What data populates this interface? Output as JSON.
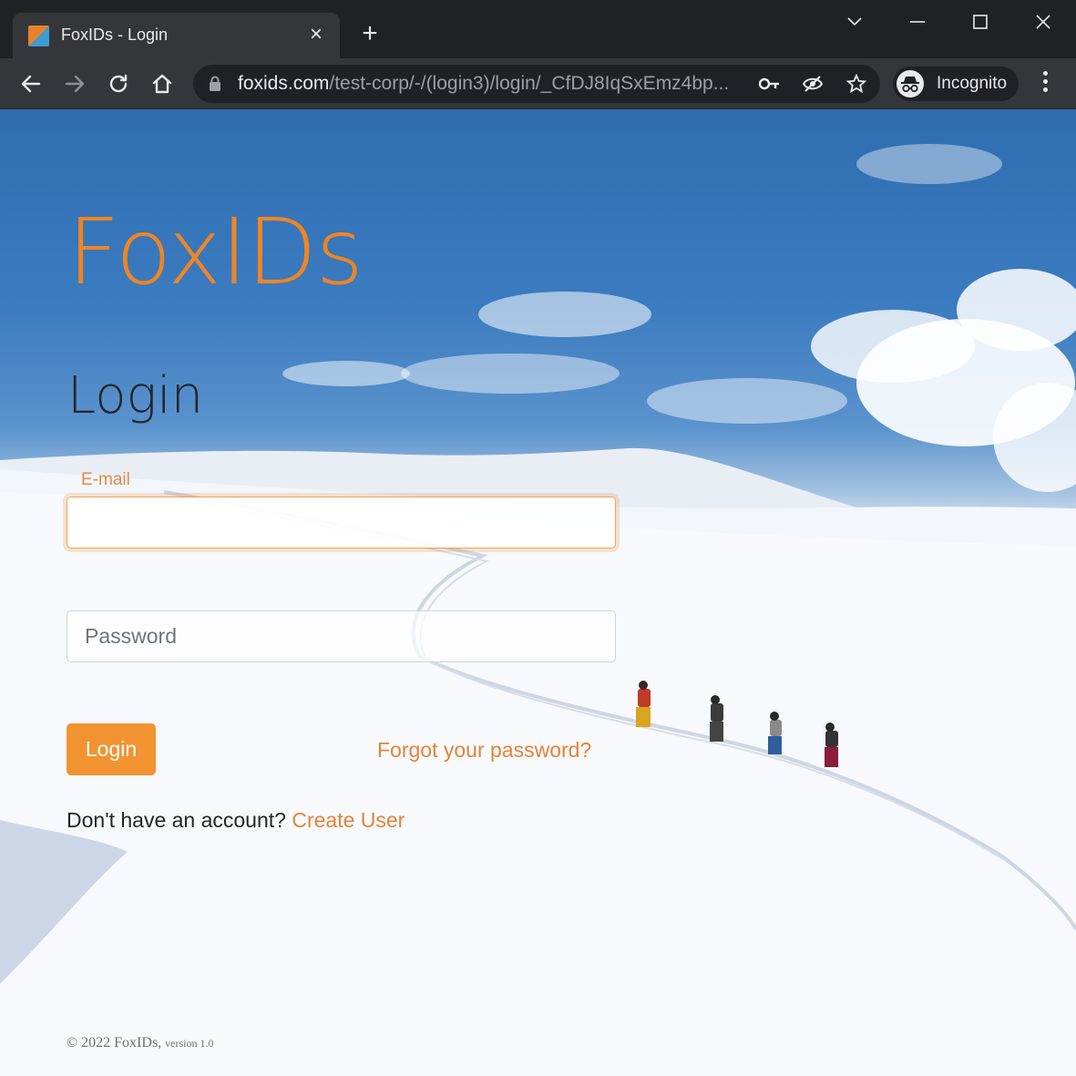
{
  "browser": {
    "tab_title": "FoxIDs - Login",
    "new_tab_label": "+",
    "url_host": "foxids.com",
    "url_path": "/test-corp/-/(login3)/login/_CfDJ8IqSxEmz4bp...",
    "profile_label": "Incognito",
    "favicon_colors": [
      "#e8822a",
      "#3e9bd1"
    ]
  },
  "page": {
    "brand": "FoxIDs",
    "heading": "Login",
    "email_label": "E-mail",
    "email_value": "",
    "password_placeholder": "Password",
    "login_button": "Login",
    "forgot_link": "Forgot your password?",
    "signup_prompt": "Don't have an account?",
    "signup_link": "Create User",
    "footer_copyright": "© 2022 FoxIDs,",
    "footer_version": "version 1.0"
  },
  "colors": {
    "accent": "#ef8523",
    "button": "#f29331",
    "link": "#e3833a",
    "sky": "#3b7bc0",
    "snow": "#f6f8fb"
  }
}
